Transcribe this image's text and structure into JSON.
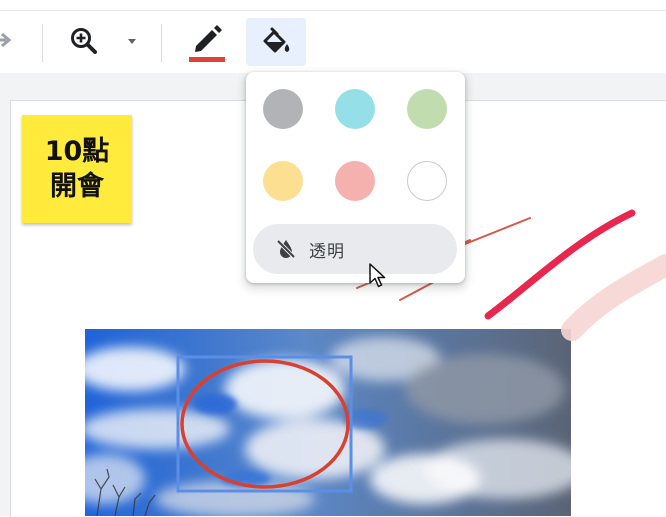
{
  "toolbar": {
    "items": [
      "redo-icon",
      "zoom-in-icon",
      "dropdown-arrow-icon",
      "pen-icon",
      "fill-bucket-icon"
    ],
    "pen_color": "#db4437",
    "active_item": "fill-bucket-icon",
    "active_bg": "#e8f0fe"
  },
  "sticky_note": {
    "line1": "10點",
    "line2": "開會",
    "color": "#ffeb3b"
  },
  "fill_menu": {
    "swatches": [
      {
        "name": "gray",
        "color": "#b1b3b6"
      },
      {
        "name": "light-blue",
        "color": "#95dfe8"
      },
      {
        "name": "light-green",
        "color": "#c1dcae"
      },
      {
        "name": "light-yellow",
        "color": "#fddf91"
      },
      {
        "name": "light-red",
        "color": "#f4b1ae"
      },
      {
        "name": "white",
        "color": "#ffffff"
      }
    ],
    "transparent_label": "透明",
    "transparent_icon": "no-fill-icon"
  }
}
